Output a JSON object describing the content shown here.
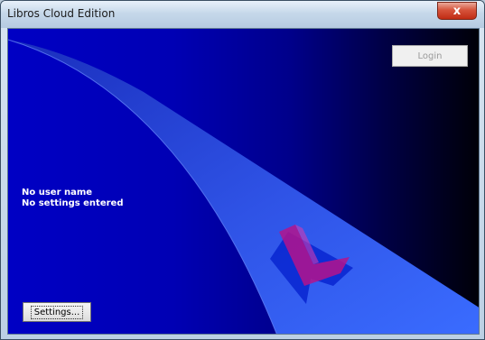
{
  "window": {
    "title": "Libros Cloud Edition",
    "close_glyph": "x"
  },
  "main": {
    "login_label": "Login",
    "status_user": "No user name",
    "status_settings": "No settings entered",
    "settings_label": "Settings..."
  },
  "icons": {
    "close": "close-icon",
    "logo": "libros-logo-icon"
  },
  "colors": {
    "background_start": "#0000c4",
    "background_end": "#000008",
    "swoosh": "#2d5cf0",
    "logo_magenta": "#b4148c",
    "logo_blue": "#0a28d2"
  }
}
